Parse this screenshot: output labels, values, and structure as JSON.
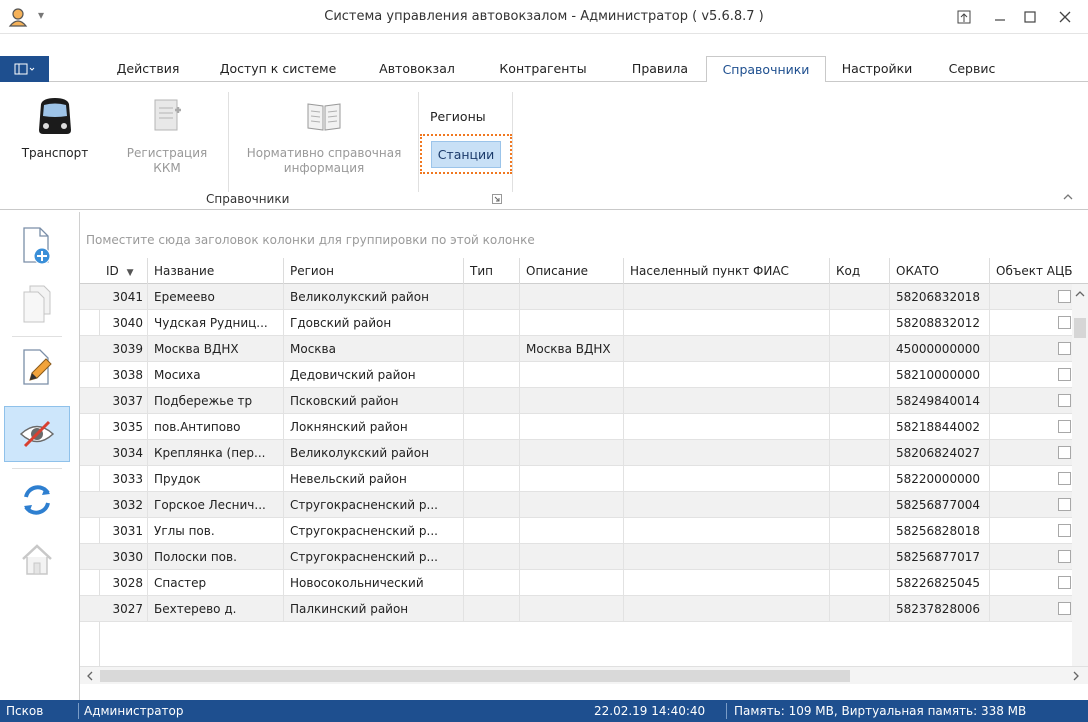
{
  "window": {
    "title": "Система управления автовокзалом - Администратор ( v5.6.8.7 )",
    "qat_glyph": "▾"
  },
  "ribbon": {
    "tabs": [
      {
        "label": "Действия"
      },
      {
        "label": "Доступ к системе"
      },
      {
        "label": "Автовокзал"
      },
      {
        "label": "Контрагенты"
      },
      {
        "label": "Правила"
      },
      {
        "label": "Справочники"
      },
      {
        "label": "Настройки"
      },
      {
        "label": "Сервис"
      }
    ],
    "active_tab": "Справочники",
    "buttons": {
      "transport": "Транспорт",
      "kkm_line1": "Регистрация",
      "kkm_line2": "ККМ",
      "nsi_line1": "Нормативно справочная",
      "nsi_line2": "информация",
      "regions": "Регионы",
      "stations": "Станции"
    },
    "group_label": "Справочники"
  },
  "grid": {
    "group_hint": "Поместите сюда заголовок колонки для группировки по этой колонке",
    "columns": [
      "ID",
      "Название",
      "Регион",
      "Тип",
      "Описание",
      "Населенный пункт ФИАС",
      "Код",
      "ОКАТО",
      "Объект АЦБ"
    ],
    "rows": [
      {
        "id": "3041",
        "name": "Еремеево",
        "region": "Великолукский район",
        "type": "",
        "desc": "",
        "fias": "",
        "code": "",
        "okato": "58206832018"
      },
      {
        "id": "3040",
        "name": "Чудская Рудниц...",
        "region": "Гдовский район",
        "type": "",
        "desc": "",
        "fias": "",
        "code": "",
        "okato": "58208832012"
      },
      {
        "id": "3039",
        "name": "Москва ВДНХ",
        "region": "Москва",
        "type": "",
        "desc": "Москва ВДНХ",
        "fias": "",
        "code": "",
        "okato": "45000000000"
      },
      {
        "id": "3038",
        "name": "Мосиха",
        "region": "Дедовичский район",
        "type": "",
        "desc": "",
        "fias": "",
        "code": "",
        "okato": "58210000000"
      },
      {
        "id": "3037",
        "name": "Подбережье тр",
        "region": "Псковский район",
        "type": "",
        "desc": "",
        "fias": "",
        "code": "",
        "okato": "58249840014"
      },
      {
        "id": "3035",
        "name": "пов.Антипово",
        "region": "Локнянский район",
        "type": "",
        "desc": "",
        "fias": "",
        "code": "",
        "okato": "58218844002"
      },
      {
        "id": "3034",
        "name": "Креплянка (пер...",
        "region": "Великолукский район",
        "type": "",
        "desc": "",
        "fias": "",
        "code": "",
        "okato": "58206824027"
      },
      {
        "id": "3033",
        "name": "Прудок",
        "region": "Невельский район",
        "type": "",
        "desc": "",
        "fias": "",
        "code": "",
        "okato": "58220000000"
      },
      {
        "id": "3032",
        "name": "Горское Леснич...",
        "region": "Стругокрасненский р...",
        "type": "",
        "desc": "",
        "fias": "",
        "code": "",
        "okato": "58256877004"
      },
      {
        "id": "3031",
        "name": "Углы пов.",
        "region": "Стругокрасненский р...",
        "type": "",
        "desc": "",
        "fias": "",
        "code": "",
        "okato": "58256828018"
      },
      {
        "id": "3030",
        "name": "Полоски пов.",
        "region": "Стругокрасненский р...",
        "type": "",
        "desc": "",
        "fias": "",
        "code": "",
        "okato": "58256877017"
      },
      {
        "id": "3028",
        "name": "Спастер",
        "region": "Новосокольнический",
        "type": "",
        "desc": "",
        "fias": "",
        "code": "",
        "okato": "58226825045"
      },
      {
        "id": "3027",
        "name": "Бехтерево д.",
        "region": "Палкинский район",
        "type": "",
        "desc": "",
        "fias": "",
        "code": "",
        "okato": "58237828006"
      }
    ]
  },
  "statusbar": {
    "city": "Псков",
    "user": "Администратор",
    "datetime": "22.02.19 14:40:40",
    "memory": "Память: 109 MB, Виртуальная память: 338 MB"
  },
  "colors": {
    "accent": "#1e4f8f",
    "selected_tool": "#cde6fb",
    "highlight_outline": "#f07820"
  }
}
